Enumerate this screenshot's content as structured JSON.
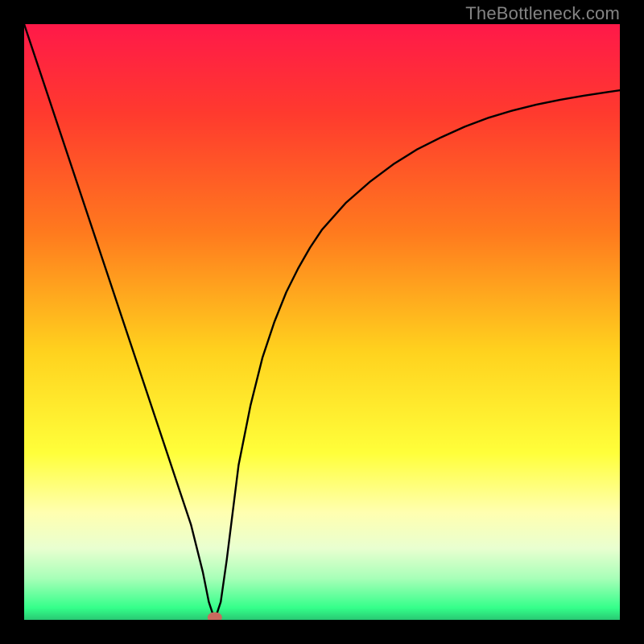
{
  "watermark": "TheBottleneck.com",
  "chart_data": {
    "type": "line",
    "title": "",
    "xlabel": "",
    "ylabel": "",
    "ylim": [
      0,
      100
    ],
    "xlim": [
      0,
      100
    ],
    "x": [
      0,
      2,
      4,
      6,
      8,
      10,
      12,
      14,
      16,
      18,
      20,
      22,
      24,
      26,
      28,
      30,
      31,
      32,
      33,
      34,
      35,
      36,
      38,
      40,
      42,
      44,
      46,
      48,
      50,
      54,
      58,
      62,
      66,
      70,
      74,
      78,
      82,
      86,
      90,
      94,
      98,
      100
    ],
    "values": [
      100,
      94,
      88,
      82,
      76,
      70,
      64,
      58,
      52,
      46,
      40,
      34,
      28,
      22,
      16,
      8,
      3,
      0,
      3,
      10,
      18,
      26,
      36,
      44,
      50,
      55,
      59,
      62.5,
      65.5,
      70,
      73.5,
      76.5,
      79,
      81,
      82.8,
      84.3,
      85.5,
      86.5,
      87.3,
      88,
      88.6,
      88.9
    ],
    "gradient": {
      "stops": [
        {
          "offset": 0.0,
          "color": "#ff1949"
        },
        {
          "offset": 0.15,
          "color": "#ff3a2e"
        },
        {
          "offset": 0.35,
          "color": "#ff7a1e"
        },
        {
          "offset": 0.55,
          "color": "#ffd21e"
        },
        {
          "offset": 0.72,
          "color": "#ffff3a"
        },
        {
          "offset": 0.82,
          "color": "#ffffb0"
        },
        {
          "offset": 0.88,
          "color": "#e9ffd0"
        },
        {
          "offset": 0.93,
          "color": "#a8ffb8"
        },
        {
          "offset": 0.98,
          "color": "#34ff8a"
        },
        {
          "offset": 1.0,
          "color": "#29c873"
        }
      ]
    },
    "marker": {
      "x": 32,
      "y": 0,
      "color": "#c96a5e",
      "radius_px": 9
    }
  }
}
